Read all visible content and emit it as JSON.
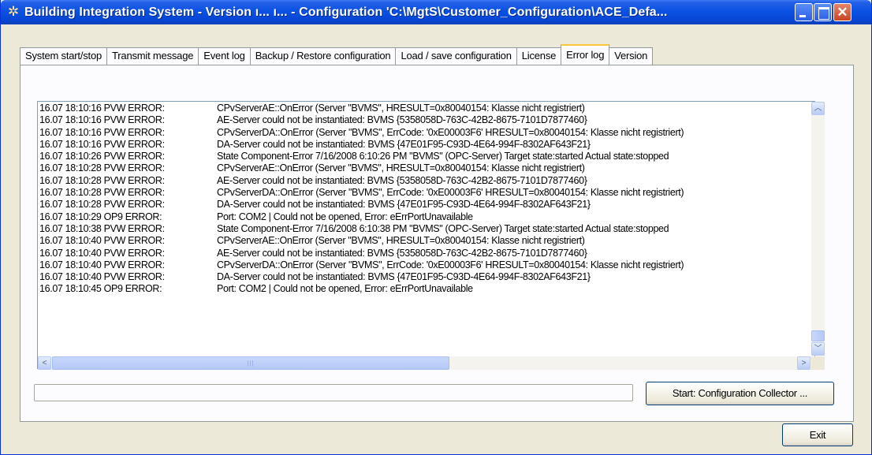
{
  "window": {
    "title": "Building Integration System - Version  ı...  ı...      - Configuration 'C:\\MgtS\\Customer_Configuration\\ACE_Defa...",
    "icon": "gear-app-icon"
  },
  "titlebar_buttons": {
    "minimize": "minimize-icon",
    "maximize": "maximize-icon",
    "close_glyph": "✕"
  },
  "tabs": [
    {
      "label": "System start/stop",
      "active": false
    },
    {
      "label": "Transmit message",
      "active": false
    },
    {
      "label": "Event log",
      "active": false
    },
    {
      "label": "Backup / Restore configuration",
      "active": false
    },
    {
      "label": "Load / save configuration",
      "active": false
    },
    {
      "label": "License",
      "active": false
    },
    {
      "label": "Error log",
      "active": true
    },
    {
      "label": "Version",
      "active": false
    }
  ],
  "error_log": [
    {
      "time": "16.07 18:10:16 PVW ERROR:",
      "message": "CPvServerAE::OnError (Server \"BVMS\", HRESULT=0x80040154: Klasse nicht registriert)"
    },
    {
      "time": "16.07 18:10:16 PVW ERROR:",
      "message": "AE-Server could not be instantiated: BVMS {5358058D-763C-42B2-8675-7101D7877460}"
    },
    {
      "time": "16.07 18:10:16 PVW ERROR:",
      "message": "CPvServerDA::OnError (Server \"BVMS\", ErrCode: '0xE00003F6' HRESULT=0x80040154: Klasse nicht registriert)"
    },
    {
      "time": "16.07 18:10:16 PVW ERROR:",
      "message": "DA-Server could not be instantiated: BVMS {47E01F95-C93D-4E64-994F-8302AF643F21}"
    },
    {
      "time": "16.07 18:10:26 PVW ERROR:",
      "message": "State Component-Error 7/16/2008 6:10:26 PM \"BVMS\" (OPC-Server) Target state:started Actual state:stopped"
    },
    {
      "time": "16.07 18:10:28 PVW ERROR:",
      "message": "CPvServerAE::OnError (Server \"BVMS\", HRESULT=0x80040154: Klasse nicht registriert)"
    },
    {
      "time": "16.07 18:10:28 PVW ERROR:",
      "message": "AE-Server could not be instantiated: BVMS {5358058D-763C-42B2-8675-7101D7877460}"
    },
    {
      "time": "16.07 18:10:28 PVW ERROR:",
      "message": "CPvServerDA::OnError (Server \"BVMS\", ErrCode: '0xE00003F6' HRESULT=0x80040154: Klasse nicht registriert)"
    },
    {
      "time": "16.07 18:10:28 PVW ERROR:",
      "message": "DA-Server could not be instantiated: BVMS {47E01F95-C93D-4E64-994F-8302AF643F21}"
    },
    {
      "time": "16.07 18:10:29 OP9 ERROR:",
      "message": "Port: COM2 | Could not be opened, Error: eErrPortUnavailable"
    },
    {
      "time": "16.07 18:10:38 PVW ERROR:",
      "message": "State Component-Error 7/16/2008 6:10:38 PM \"BVMS\" (OPC-Server) Target state:started Actual state:stopped"
    },
    {
      "time": "16.07 18:10:40 PVW ERROR:",
      "message": "CPvServerAE::OnError (Server \"BVMS\", HRESULT=0x80040154: Klasse nicht registriert)"
    },
    {
      "time": "16.07 18:10:40 PVW ERROR:",
      "message": "AE-Server could not be instantiated: BVMS {5358058D-763C-42B2-8675-7101D7877460}"
    },
    {
      "time": "16.07 18:10:40 PVW ERROR:",
      "message": "CPvServerDA::OnError (Server \"BVMS\", ErrCode: '0xE00003F6' HRESULT=0x80040154: Klasse nicht registriert)"
    },
    {
      "time": "16.07 18:10:40 PVW ERROR:",
      "message": "DA-Server could not be instantiated: BVMS {47E01F95-C93D-4E64-994F-8302AF643F21}"
    },
    {
      "time": "16.07 18:10:45 OP9 ERROR:",
      "message": "Port: COM2 | Could not be opened, Error: eErrPortUnavailable"
    }
  ],
  "scrollbars": {
    "up_glyph": "︿",
    "down_glyph": "﹀",
    "left_glyph": "<",
    "right_glyph": ">",
    "thumb_grip": "|||"
  },
  "progress": {
    "value": 0
  },
  "buttons": {
    "collector": "Start:  Configuration Collector ...",
    "exit": "Exit"
  },
  "colors": {
    "titlebar": "#0a52e3",
    "active_tab_accent": "#ffc83c",
    "window_bg": "#ece9d8"
  }
}
